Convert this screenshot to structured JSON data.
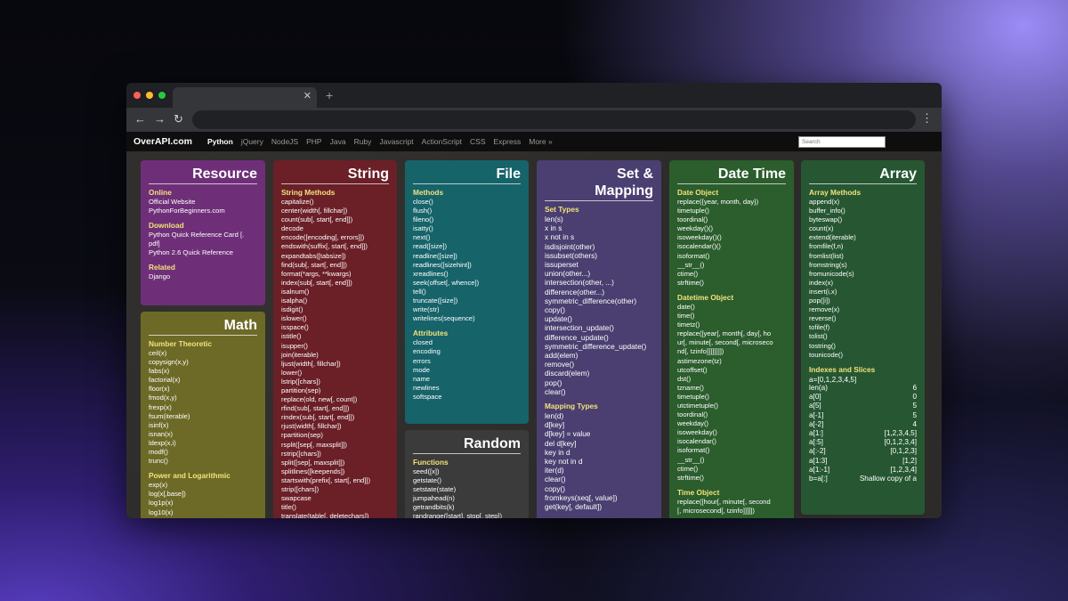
{
  "browser": {
    "tab_close": "✕",
    "new_tab": "+",
    "back": "←",
    "forward": "→",
    "reload": "↻",
    "menu": "⋮"
  },
  "site": {
    "logo": "OverAPI.com",
    "nav": [
      "Python",
      "jQuery",
      "NodeJS",
      "PHP",
      "Java",
      "Ruby",
      "Javascript",
      "ActionScript",
      "CSS",
      "Express",
      "More »"
    ],
    "search_placeholder": "Search"
  },
  "cards": {
    "resource": {
      "title": "Resource",
      "sections": [
        {
          "heading": "Online",
          "items": [
            "Official Website",
            "PythonForBeginners.com"
          ]
        },
        {
          "heading": "Download",
          "items": [
            "Python Quick Reference Card [.",
            "pdf]",
            "Python 2.6 Quick Reference"
          ]
        },
        {
          "heading": "Related",
          "items": [
            "Django"
          ]
        }
      ]
    },
    "math": {
      "title": "Math",
      "sections": [
        {
          "heading": "Number Theoretic",
          "items": [
            "ceil(x)",
            "copysign(x,y)",
            "fabs(x)",
            "factorial(x)",
            "floor(x)",
            "fmod(x,y)",
            "frexp(x)",
            "fsum(iterable)",
            "isinf(x)",
            "isnan(x)",
            "ldexp(x,i)",
            "modf()",
            "trunc()"
          ]
        },
        {
          "heading": "Power and Logarithmic",
          "items": [
            "exp(x)",
            "log(x[,base])",
            "log1p(x)",
            "log10(x)"
          ]
        }
      ]
    },
    "string": {
      "title": "String",
      "sections": [
        {
          "heading": "String Methods",
          "items": [
            "capitalize()",
            "center(width[, fillchar])",
            "count(sub[, start[, end]])",
            "decode",
            "encode([encoding[, errors]])",
            "endswith(suffix[, start[, end]])",
            "expandtabs([tabsize])",
            "find(sub[, start[, end]])",
            "format(*args, **kwargs)",
            "index(sub[, start[, end]])",
            "isalnum()",
            "isalpha()",
            "isdigit()",
            "islower()",
            "isspace()",
            "istitle()",
            "isupper()",
            "join(iterable)",
            "ljust(width[, fillchar])",
            "lower()",
            "lstrip([chars])",
            "partition(sep)",
            "replace(old, new[, count])",
            "rfind(sub[, start[, end]])",
            "rindex(sub[, start[, end]])",
            "rjust(width[, fillchar])",
            "rpartition(sep)",
            "rsplit([sep[, maxsplit]])",
            "rstrip([chars])",
            "split([sep[, maxsplit]])",
            "splitlines([keepends])",
            "startswith(prefix[, start[, end]])",
            "strip([chars])",
            "swapcase",
            "title()",
            "translate(table[, deletechars])"
          ]
        }
      ]
    },
    "file": {
      "title": "File",
      "sections": [
        {
          "heading": "Methods",
          "items": [
            "close()",
            "flush()",
            "fileno()",
            "isatty()",
            "next()",
            "read([size])",
            "readline([size])",
            "readlines([sizehint])",
            "xreadlines()",
            "seek(offset[, whence])",
            "tell()",
            "truncate([size])",
            "write(str)",
            "writelines(sequence)"
          ]
        },
        {
          "heading": "Attributes",
          "items": [
            "closed",
            "encoding",
            "errors",
            "mode",
            "name",
            "newlines",
            "softspace"
          ]
        }
      ]
    },
    "random": {
      "title": "Random",
      "sections": [
        {
          "heading": "Functions",
          "items": [
            "seed([x])",
            "getstate()",
            "setstate(state)",
            "jumpahead(n)",
            "getrandbits(k)",
            "randrange([start], stop[, step])"
          ]
        }
      ]
    },
    "set": {
      "title_line1": "Set &",
      "title_line2": "Mapping",
      "sections": [
        {
          "heading": "Set Types",
          "items": [
            "len(s)",
            "x in s",
            "x not in s",
            "isdisjoint(other)",
            "issubset(others)",
            "issuperset",
            "union(other...)",
            "intersection(other, ...)",
            "difference(other...)",
            "symmetric_difference(other)",
            "copy()",
            "update()",
            "intersection_update()",
            "difference_update()",
            "symmetric_difference_update()",
            "add(elem)",
            "remove()",
            "discard(elem)",
            "pop()",
            "clear()"
          ]
        },
        {
          "heading": "Mapping Types",
          "items": [
            "len(d)",
            "d[key]",
            "d[key] = value",
            "del d[key]",
            "key in d",
            "key not in d",
            "iter(d)",
            "clear()",
            "copy()",
            "fromkeys(seq[, value])",
            "get(key[, default])"
          ]
        }
      ]
    },
    "date": {
      "title": "Date Time",
      "sections": [
        {
          "heading": "Date Object",
          "items": [
            "replace({year, month, day})",
            "timetuple()",
            "toordinal()",
            "weekday()()",
            "isoweekday()()",
            "isocalendar()()",
            "isoformat()",
            "__str__()",
            "ctime()",
            "strftime()"
          ]
        },
        {
          "heading": "Datetime Object",
          "items": [
            "date()",
            "time()",
            "timetz()",
            "replace([year[, month[, day[, ho",
            "ur[, minute[, second[, microseco",
            "nd[, tzinfo]]]]]]]])",
            "astimezone(tz)",
            "utcoffset()",
            "dst()",
            "tzname()",
            "timetuple()",
            "utctimetuple()",
            "toordinal()",
            "weekday()",
            "isoweekday()",
            "isocalendar()",
            "isoformat()",
            "__str__()",
            "ctime()",
            "strftime()"
          ]
        },
        {
          "heading": "Time Object",
          "items": [
            "replace([hour[, minute[, second",
            "[, microsecond[, tzinfo]]]]])"
          ]
        }
      ]
    },
    "array": {
      "title": "Array",
      "methods_heading": "Array Methods",
      "methods": [
        "append(x)",
        "buffer_info()",
        "byteswap()",
        "count(x)",
        "extend(iterable)",
        "fromfile(f,n)",
        "fromlist(list)",
        "fromstring(s)",
        "fromunicode(s)",
        "index(x)",
        "insert(i,x)",
        "pop([i])",
        "remove(x)",
        "reverse()",
        "tofile(f)",
        "tolist()",
        "tostring()",
        "tounicode()"
      ],
      "slices_heading": "Indexes and Slices",
      "slices_intro": "a=[0,1,2,3,4,5]",
      "slices": [
        {
          "expr": "len(a)",
          "result": "6"
        },
        {
          "expr": "a[0]",
          "result": "0"
        },
        {
          "expr": "a[5]",
          "result": "5"
        },
        {
          "expr": "a[-1]",
          "result": "5"
        },
        {
          "expr": "a[-2]",
          "result": "4"
        },
        {
          "expr": "a[1:]",
          "result": "[1,2,3,4,5]"
        },
        {
          "expr": "a[:5]",
          "result": "[0,1,2,3,4]"
        },
        {
          "expr": "a[:-2]",
          "result": "[0,1,2,3]"
        },
        {
          "expr": "a[1:3]",
          "result": "[1,2]"
        },
        {
          "expr": "a[1:-1]",
          "result": "[1,2,3,4]"
        },
        {
          "expr": "b=a[:]",
          "result": "Shallow copy of a"
        }
      ]
    }
  },
  "scroll_tab": "︿"
}
